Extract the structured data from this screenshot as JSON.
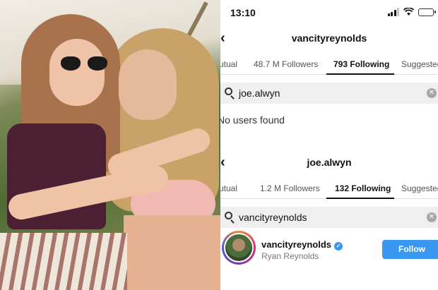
{
  "status": {
    "time": "13:10"
  },
  "screen1": {
    "title": "vancityreynolds",
    "tabs": [
      {
        "label": "Mutual"
      },
      {
        "label": "48.7 M Followers"
      },
      {
        "label": "793 Following"
      },
      {
        "label": "Suggested"
      }
    ],
    "search_query": "joe.alwyn",
    "empty_message": "No users found"
  },
  "screen2": {
    "title": "joe.alwyn",
    "tabs": [
      {
        "label": "Mutual"
      },
      {
        "label": "1.2 M Followers"
      },
      {
        "label": "132 Following"
      },
      {
        "label": "Suggested"
      }
    ],
    "search_query": "vancityreynolds",
    "result": {
      "username": "vancityreynolds",
      "full_name": "Ryan Reynolds",
      "verified": true,
      "follow_label": "Follow"
    }
  },
  "icons": {
    "back": "chevron-left-icon",
    "search": "search-icon",
    "clear": "clear-icon",
    "verified": "verified-badge-icon"
  },
  "colors": {
    "accent": "#3897f0"
  }
}
